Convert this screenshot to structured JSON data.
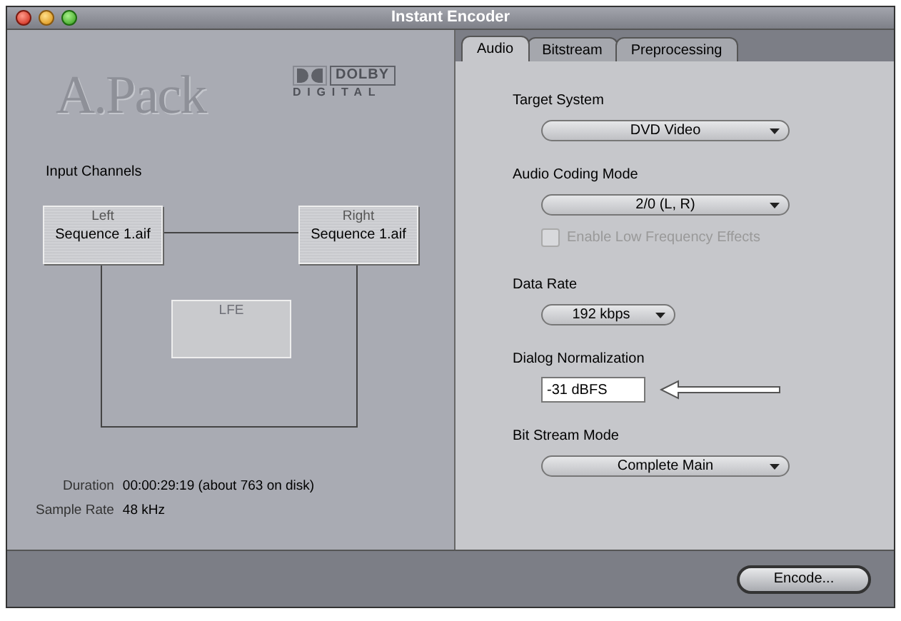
{
  "window": {
    "title": "Instant Encoder"
  },
  "logo": {
    "product": "A.Pack",
    "brand": "DOLBY",
    "brand_sub": "DIGITAL"
  },
  "input_channels": {
    "label": "Input Channels",
    "channels": [
      {
        "name": "Left",
        "file": "Sequence 1.aif",
        "disabled": false
      },
      {
        "name": "Right",
        "file": "Sequence 1.aif",
        "disabled": false
      },
      {
        "name": "LFE",
        "disabled": true
      }
    ]
  },
  "info": [
    {
      "label": "Duration",
      "value": "00:00:29:19 (about 763 on disk)"
    },
    {
      "label": "Sample Rate",
      "value": "48 kHz"
    }
  ],
  "tabs": [
    {
      "label": "Audio",
      "selected": true
    },
    {
      "label": "Bitstream",
      "selected": false
    },
    {
      "label": "Preprocessing",
      "selected": false
    }
  ],
  "settings": [
    {
      "kind": "dropdown",
      "label": "Target System",
      "value": "DVD Video"
    },
    {
      "kind": "dropdown",
      "label": "Audio Coding Mode",
      "value": "2/0 (L, R)"
    },
    {
      "kind": "checkbox",
      "label": "Enable Low Frequency Effects",
      "checked": false,
      "disabled": true
    },
    {
      "kind": "compact_dropdown",
      "label": "Data Rate",
      "value": "192 kbps"
    },
    {
      "kind": "text_field",
      "label": "Dialog Normalization",
      "value": "-31 dBFS",
      "callout": true
    },
    {
      "kind": "dropdown",
      "label": "Bit Stream Mode",
      "value": "Complete Main"
    }
  ],
  "buttons": [
    {
      "label": "Encode..."
    }
  ]
}
